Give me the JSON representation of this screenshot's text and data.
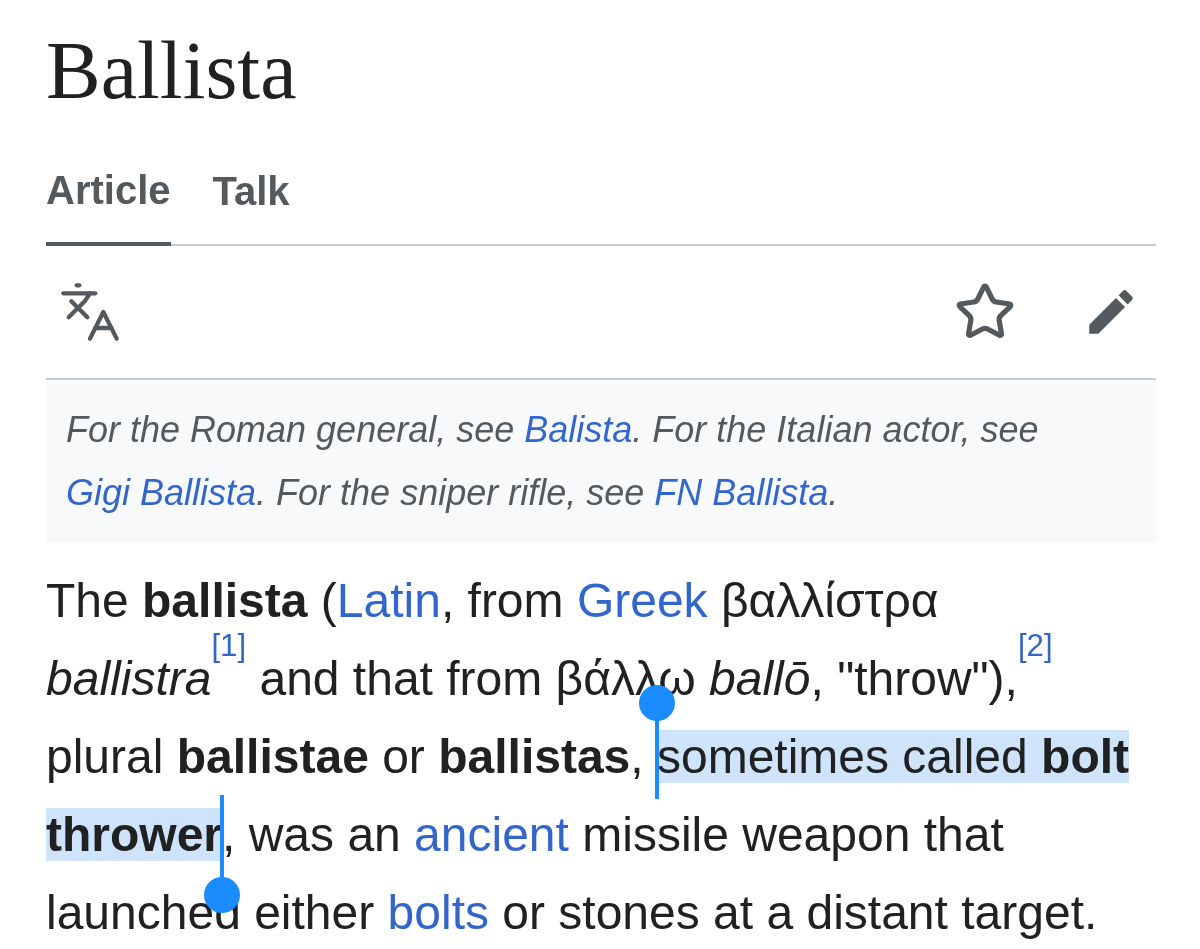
{
  "title": "Ballista",
  "tabs": [
    {
      "label": "Article",
      "selected": true
    },
    {
      "label": "Talk",
      "selected": false
    }
  ],
  "hatnote": [
    {
      "kind": "text",
      "text": "For the Roman general, see "
    },
    {
      "kind": "link",
      "text": "Balista"
    },
    {
      "kind": "text",
      "text": ". For the Italian actor, see "
    },
    {
      "kind": "link",
      "text": "Gigi Ballista"
    },
    {
      "kind": "text",
      "text": ". For the sniper rifle, see "
    },
    {
      "kind": "link",
      "text": "FN Ballista"
    },
    {
      "kind": "text",
      "text": "."
    }
  ],
  "paragraph": [
    {
      "kind": "text",
      "text": "The ",
      "selected": false
    },
    {
      "kind": "bold",
      "text": "ballista",
      "selected": false
    },
    {
      "kind": "text",
      "text": " (",
      "selected": false
    },
    {
      "kind": "link",
      "text": "Latin",
      "selected": false
    },
    {
      "kind": "text",
      "text": ", from ",
      "selected": false
    },
    {
      "kind": "link",
      "text": "Greek",
      "selected": false
    },
    {
      "kind": "text",
      "text": " βαλλίστρα ",
      "selected": false
    },
    {
      "kind": "italic",
      "text": "ballistra",
      "selected": false
    },
    {
      "kind": "ref",
      "text": "[1]",
      "selected": false
    },
    {
      "kind": "text",
      "text": " and that from βάλλω ",
      "selected": false
    },
    {
      "kind": "italic",
      "text": "ballō",
      "selected": false
    },
    {
      "kind": "text",
      "text": ", \"throw\"),",
      "selected": false
    },
    {
      "kind": "ref",
      "text": "[2]",
      "selected": false
    },
    {
      "kind": "text",
      "text": " plural ",
      "selected": false
    },
    {
      "kind": "bold",
      "text": "ballistae",
      "selected": false
    },
    {
      "kind": "text",
      "text": " or ",
      "selected": false
    },
    {
      "kind": "bold",
      "text": "ballistas",
      "selected": false
    },
    {
      "kind": "text",
      "text": ", ",
      "selected": false
    },
    {
      "kind": "text",
      "text": "sometimes called ",
      "selected": true
    },
    {
      "kind": "bold",
      "text": "bolt thrower",
      "selected": true
    },
    {
      "kind": "text",
      "text": ", was an ",
      "selected": false
    },
    {
      "kind": "link",
      "text": "ancient",
      "selected": false
    },
    {
      "kind": "text",
      "text": " missile weapon that launched either ",
      "selected": false
    },
    {
      "kind": "link",
      "text": "bolts",
      "selected": false
    },
    {
      "kind": "text",
      "text": " or stones at a distant target.",
      "selected": false
    }
  ]
}
